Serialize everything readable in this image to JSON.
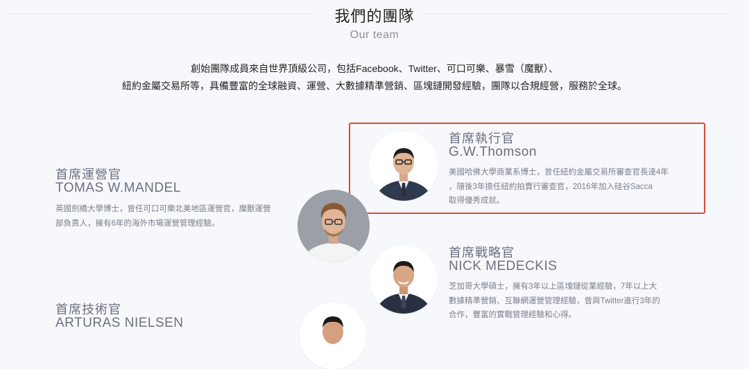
{
  "header": {
    "title": "我們的團隊",
    "subtitle": "Our team"
  },
  "intro": {
    "line1": "創始團隊成員來自世界頂級公司，包括Facebook、Twitter、可口可樂、暴雪（魔獸）、",
    "line2": "紐約金屬交易所等，具備豐富的全球融資、運營、大數據精準營銷、區塊鏈開發經驗，團隊以合規經營，服務於全球。"
  },
  "members": {
    "ceo": {
      "role": "首席執行官",
      "name": "G.W.Thomson",
      "desc": [
        "美國哈佛大學商業系博士，曾任紐約金屬交易所審查官長達4年",
        "，隨後3年擔任紐約拍賣行審查官，2016年加入硅谷Sacca",
        "取得優秀成就。"
      ]
    },
    "coo": {
      "role": "首席運營官",
      "name": "TOMAS W.MANDEL",
      "desc": [
        "英國劍橋大學博士，曾任可口可樂北美地區運營官，魔獸運營",
        "部負責人，擁有6年的海外市場運營管理經驗。"
      ]
    },
    "cso": {
      "role": "首席戰略官",
      "name": "NICK MEDECKIS",
      "desc": [
        "芝加哥大學碩士，擁有3年以上區塊鏈從業經驗，7年以上大",
        "數據精準營銷、互聯網運營管理經驗，曾與Twitter進行3年的",
        "合作，豐富的實戰管理經驗和心得。"
      ]
    },
    "cto": {
      "role": "首席技術官",
      "name": "ARTURAS NIELSEN"
    }
  }
}
